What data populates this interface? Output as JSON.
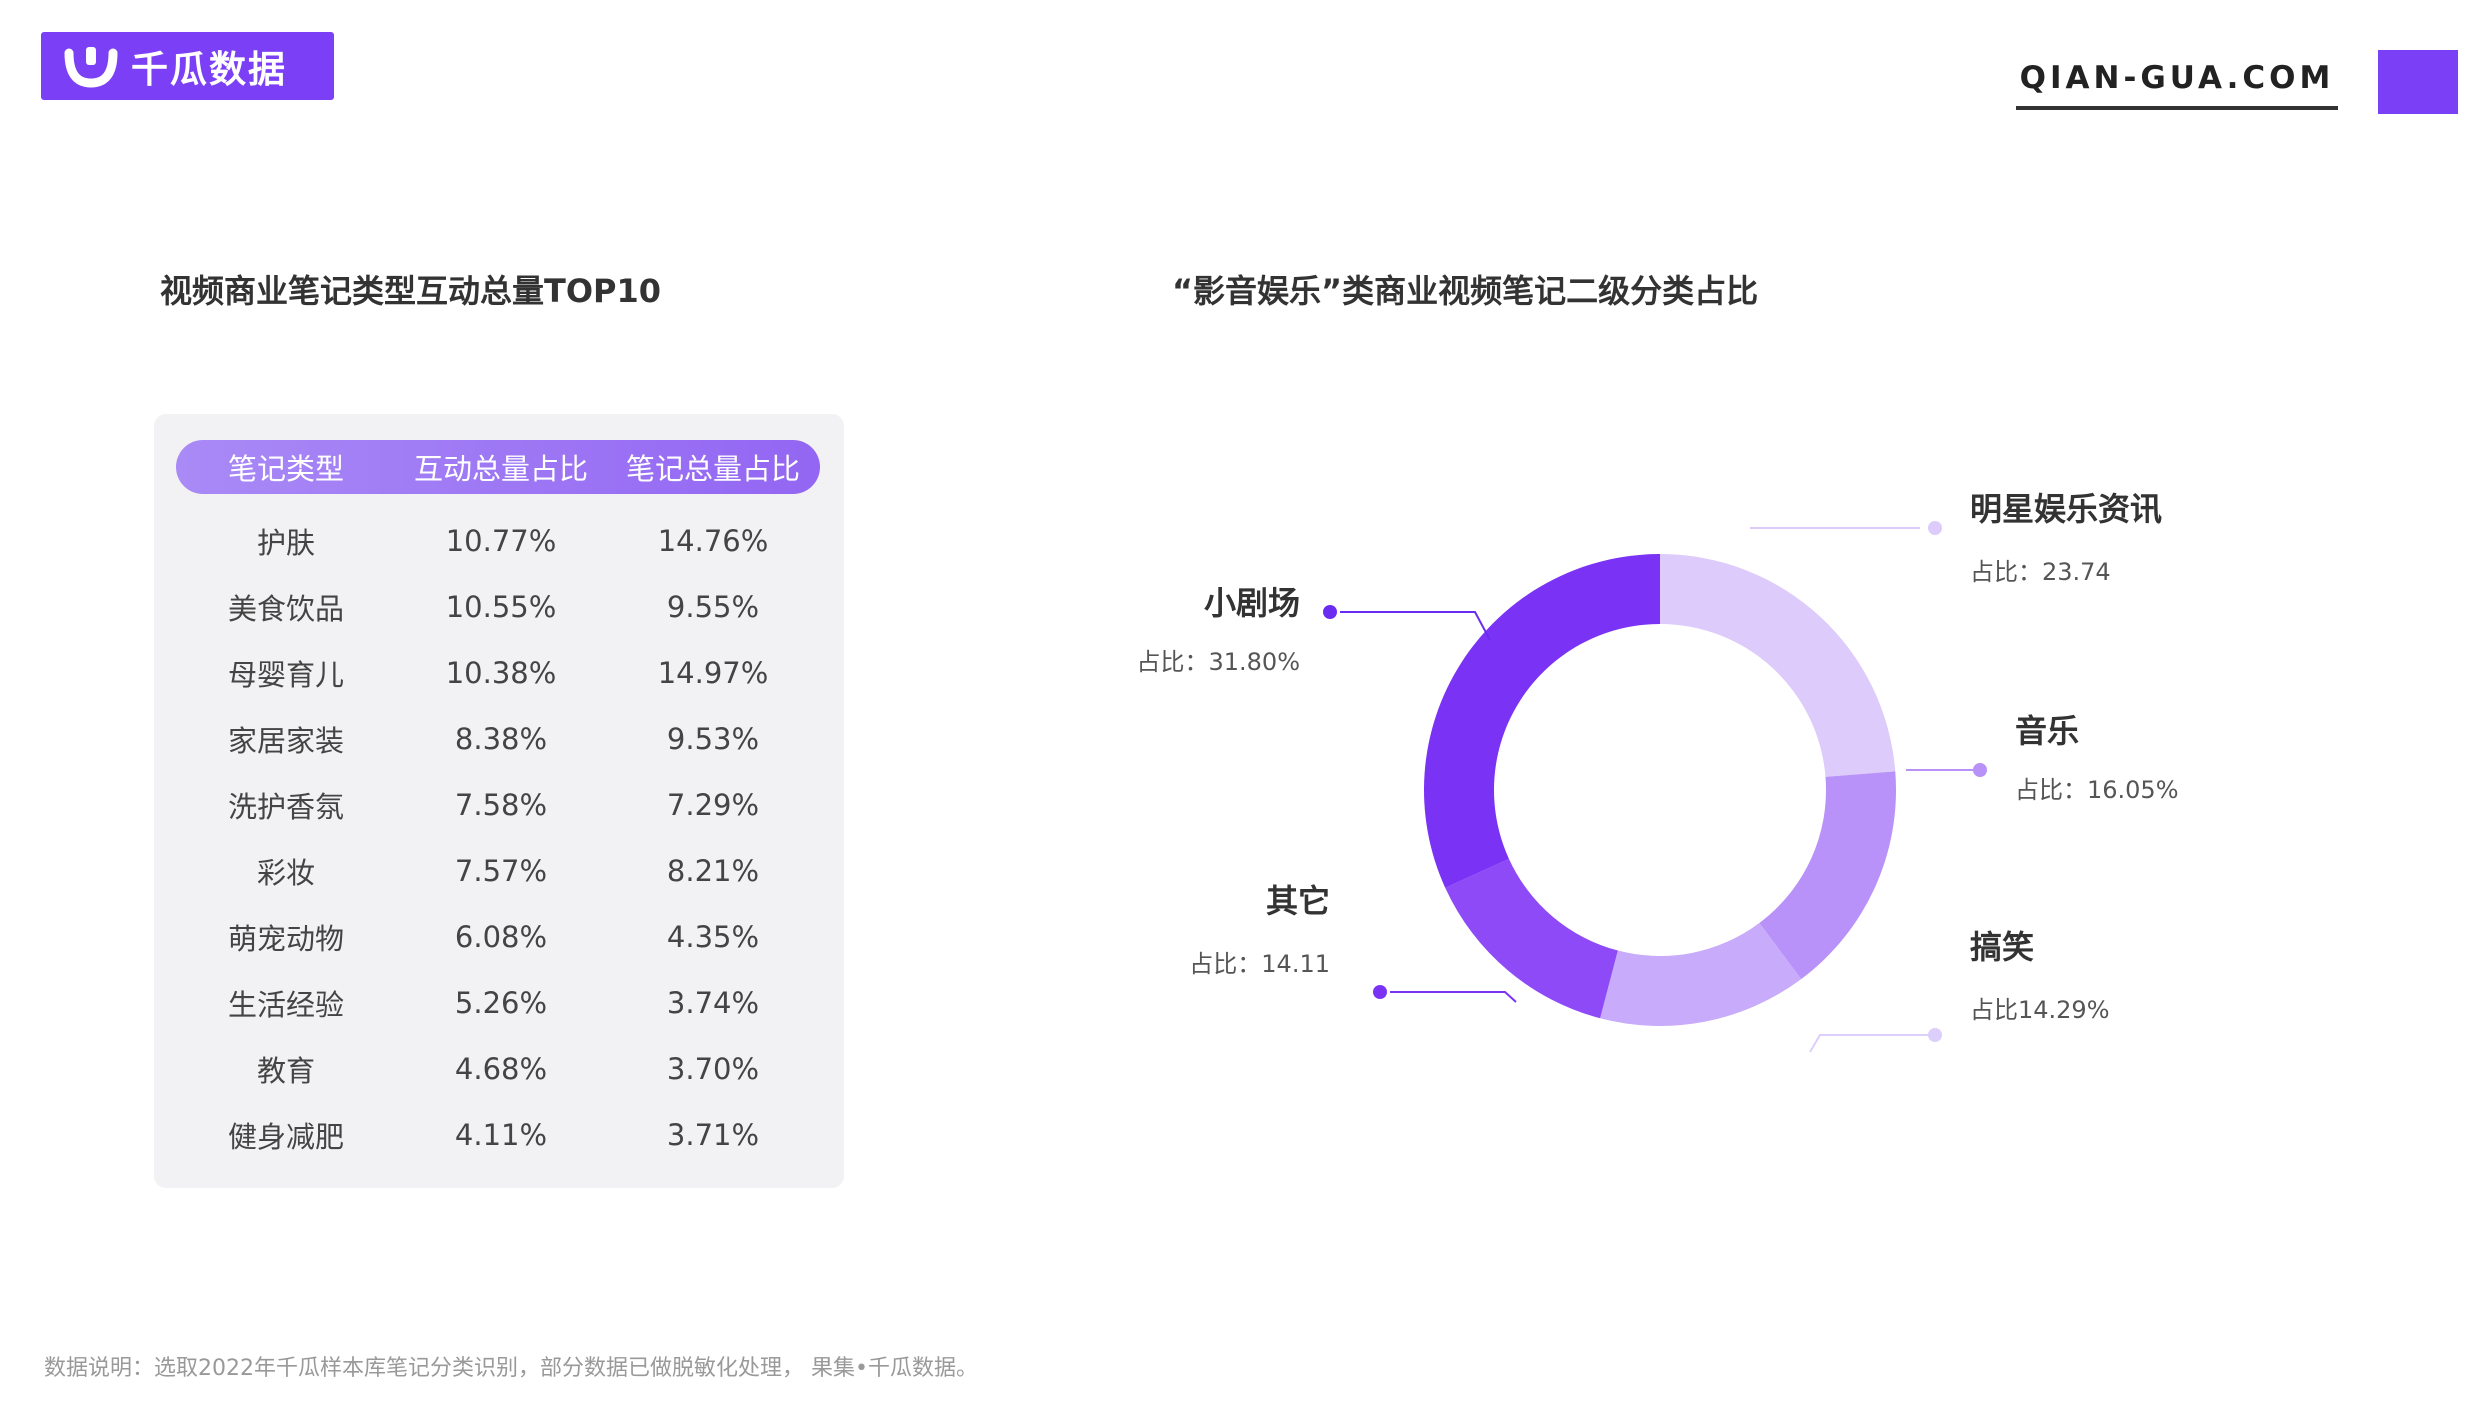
{
  "brand": {
    "name": "千瓜数据",
    "url": "QIAN-GUA.COM",
    "color": "#7b3ff5"
  },
  "left": {
    "title": "视频商业笔记类型互动总量TOP10",
    "headers": [
      "笔记类型",
      "互动总量占比",
      "笔记总量占比"
    ],
    "rows": [
      [
        "护肤",
        "10.77%",
        "14.76%"
      ],
      [
        "美食饮品",
        "10.55%",
        "9.55%"
      ],
      [
        "母婴育儿",
        "10.38%",
        "14.97%"
      ],
      [
        "家居家装",
        "8.38%",
        "9.53%"
      ],
      [
        "洗护香氛",
        "7.58%",
        "7.29%"
      ],
      [
        "彩妆",
        "7.57%",
        "8.21%"
      ],
      [
        "萌宠动物",
        "6.08%",
        "4.35%"
      ],
      [
        "生活经验",
        "5.26%",
        "3.74%"
      ],
      [
        "教育",
        "4.68%",
        "3.70%"
      ],
      [
        "健身减肥",
        "4.11%",
        "3.71%"
      ]
    ]
  },
  "right": {
    "title": "“影音娱乐”类商业视频笔记二级分类占比"
  },
  "chart_data": {
    "type": "pie",
    "title": "“影音娱乐”类商业视频笔记二级分类占比",
    "slices": [
      {
        "name": "明星娱乐资讯",
        "value": 23.74,
        "label": "占比：23.74",
        "color": "#dccbfb"
      },
      {
        "name": "音乐",
        "value": 16.05,
        "label": "占比：16.05%",
        "color": "#b892f8"
      },
      {
        "name": "搞笑",
        "value": 14.29,
        "label": "占比14.29%",
        "color": "#c8abfa"
      },
      {
        "name": "其它",
        "value": 14.11,
        "label": "占比：14.11",
        "color": "#8e4af7"
      },
      {
        "name": "小剧场",
        "value": 31.8,
        "label": "占比：31.80%",
        "color": "#7a32f5"
      }
    ]
  },
  "footnote": "数据说明：选取2022年千瓜样本库笔记分类识别，部分数据已做脱敏化处理， 果集•千瓜数据。"
}
